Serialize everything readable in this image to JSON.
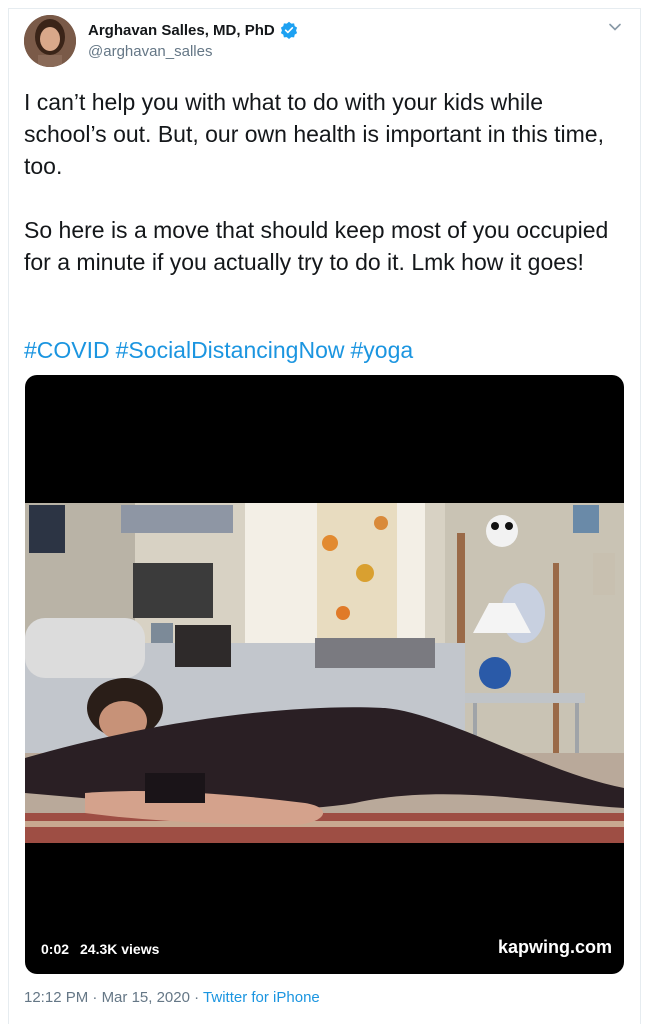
{
  "author": {
    "name": "Arghavan Salles, MD, PhD",
    "handle": "@arghavan_salles",
    "verified_icon": "verified-badge-icon",
    "menu_icon": "chevron-down-icon"
  },
  "tweet": {
    "paragraph1": "I can’t help you with what to do with your kids while school’s out. But, our own health is important in this time, too.",
    "paragraph2": "So here is a move that should keep most of you occupied for a minute if you actually try to do it. Lmk how it goes!",
    "hashtags": [
      "#COVID",
      "#SocialDistancingNow",
      "#yoga"
    ]
  },
  "video": {
    "time": "0:02",
    "views": "24.3K views",
    "watermark": "kapwing.com"
  },
  "meta": {
    "time": "12:12 PM",
    "separator": "·",
    "date": "Mar 15, 2020",
    "source": "Twitter for iPhone"
  },
  "colors": {
    "link": "#1b95e0",
    "secondary_text": "#657786",
    "verified": "#1da1f2"
  }
}
